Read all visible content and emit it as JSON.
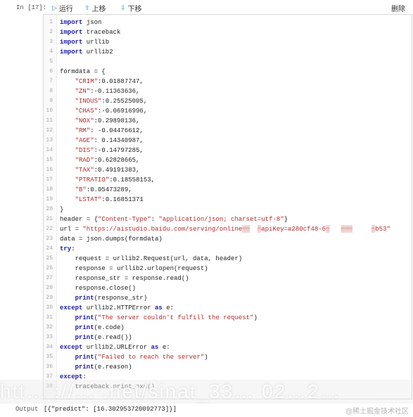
{
  "cell": {
    "prompt": "In [17]:",
    "toolbar": {
      "run_label": "运行",
      "up_label": "上移",
      "down_label": "下移",
      "delete_label": "删除",
      "run_icon": "play-icon",
      "up_icon": "arrow-up-icon",
      "down_icon": "arrow-down-icon"
    }
  },
  "code_lines": [
    {
      "n": "1",
      "t": "import json"
    },
    {
      "n": "2",
      "t": "import traceback"
    },
    {
      "n": "3",
      "t": "import urllib"
    },
    {
      "n": "4",
      "t": "import urllib2"
    },
    {
      "n": "5",
      "t": ""
    },
    {
      "n": "6",
      "t": "formdata = {"
    },
    {
      "n": "7",
      "t": "    \"CRIM\":0.01887747,"
    },
    {
      "n": "8",
      "t": "    \"ZN\":-0.11363636,"
    },
    {
      "n": "9",
      "t": "    \"INDUS\":0.25525005,"
    },
    {
      "n": "10",
      "t": "    \"CHAS\":-0.06916996,"
    },
    {
      "n": "11",
      "t": "    \"NOX\":0.29898136,"
    },
    {
      "n": "12",
      "t": "    \"RM\": -0.04476612,"
    },
    {
      "n": "13",
      "t": "    \"AGE\": 0.14340987,"
    },
    {
      "n": "14",
      "t": "    \"DIS\":-0.14797285,"
    },
    {
      "n": "15",
      "t": "    \"RAD\":0.62828665,"
    },
    {
      "n": "16",
      "t": "    \"TAX\":0.49191383,"
    },
    {
      "n": "17",
      "t": "    \"PTRATIO\":0.18558153,"
    },
    {
      "n": "18",
      "t": "    \"B\":0.05473289,"
    },
    {
      "n": "19",
      "t": "    \"LSTAT\":0.16851371"
    },
    {
      "n": "20",
      "t": "}"
    },
    {
      "n": "21",
      "t": "header = {\"Content-Type\": \"application/json; charset=utf-8\"}"
    },
    {
      "n": "22",
      "t": "url = \"https://aistudio.baidu.com/serving/online▒▒  ▒apiKey=a280cf48-6▒   ▒▒▒     ▒b53\""
    },
    {
      "n": "23",
      "t": "data = json.dumps(formdata)"
    },
    {
      "n": "24",
      "t": "try:"
    },
    {
      "n": "25",
      "t": "    request = urllib2.Request(url, data, header)"
    },
    {
      "n": "26",
      "t": "    response = urllib2.urlopen(request)"
    },
    {
      "n": "27",
      "t": "    response_str = response.read()"
    },
    {
      "n": "28",
      "t": "    response.close()"
    },
    {
      "n": "29",
      "t": "    print(response_str)"
    },
    {
      "n": "30",
      "t": "except urllib2.HTTPError as e:"
    },
    {
      "n": "31",
      "t": "    print(\"The server couldn't fulfill the request\")"
    },
    {
      "n": "32",
      "t": "    print(e.code)"
    },
    {
      "n": "33",
      "t": "    print(e.read())"
    },
    {
      "n": "34",
      "t": "except urllib2.URLError as e:"
    },
    {
      "n": "35",
      "t": "    print(\"Failed to reach the server\")"
    },
    {
      "n": "36",
      "t": "    print(e.reason)"
    },
    {
      "n": "37",
      "t": "except:"
    },
    {
      "n": "38",
      "t": "    traceback.print_exc()"
    }
  ],
  "output": {
    "label": "Output",
    "text": "[{\"predict\": [16.302953720092773]}]"
  },
  "watermark": "@稀土掘金技术社区",
  "blur_overlay_text": "htt… ://… .net/sinat_33… 02…2…"
}
